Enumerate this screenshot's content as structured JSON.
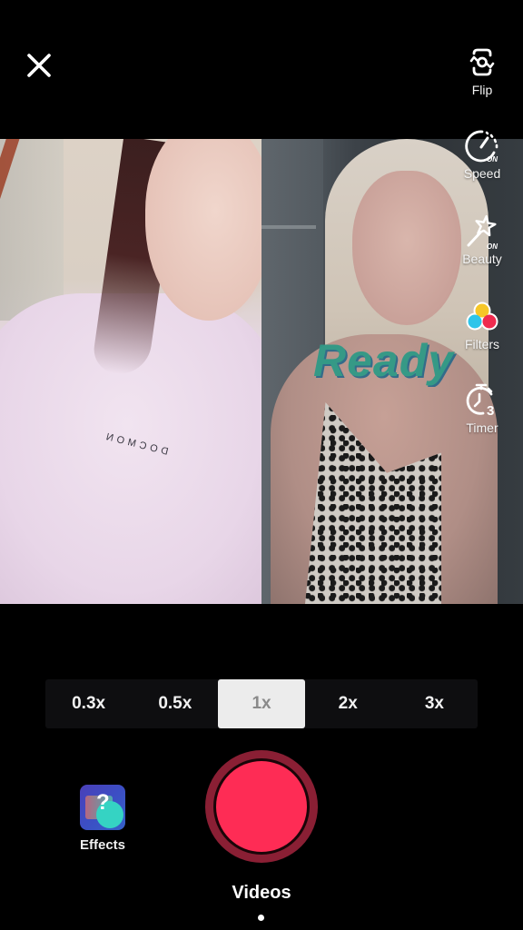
{
  "screen": {
    "type": "duet-camera-recorder",
    "colors": {
      "record_button": "#fe2c55",
      "record_ring": "#8a1f34",
      "speed_active_bg": "#ececec",
      "speed_bar_bg": "#0e0e10",
      "overlay_text": "#2f9a86"
    }
  },
  "top_bar": {
    "close_icon": "close-icon"
  },
  "side_tools": [
    {
      "id": "flip",
      "label": "Flip",
      "icon": "flip-camera-icon"
    },
    {
      "id": "speed",
      "label": "Speed",
      "icon": "speed-gauge-icon",
      "badge": "ON"
    },
    {
      "id": "beauty",
      "label": "Beauty",
      "icon": "magic-wand-icon",
      "badge": "ON"
    },
    {
      "id": "filters",
      "label": "Filters",
      "icon": "filters-icon"
    },
    {
      "id": "timer",
      "label": "Timer",
      "icon": "timer-icon",
      "badge": "3"
    }
  ],
  "video_panels": {
    "left": {
      "description": "Original video: woman in pink sweater",
      "shirt_text": "DOCMON"
    },
    "right": {
      "description": "Duet camera: woman in leopard-print top"
    },
    "overlay_text": "Ready"
  },
  "speed_selector": {
    "options": [
      "0.3x",
      "0.5x",
      "1x",
      "2x",
      "3x"
    ],
    "selected": "1x"
  },
  "bottom": {
    "effects_label": "Effects",
    "effects_icon": "effects-thumbnail-icon",
    "record_icon": "record-button",
    "mode_label": "Videos"
  }
}
